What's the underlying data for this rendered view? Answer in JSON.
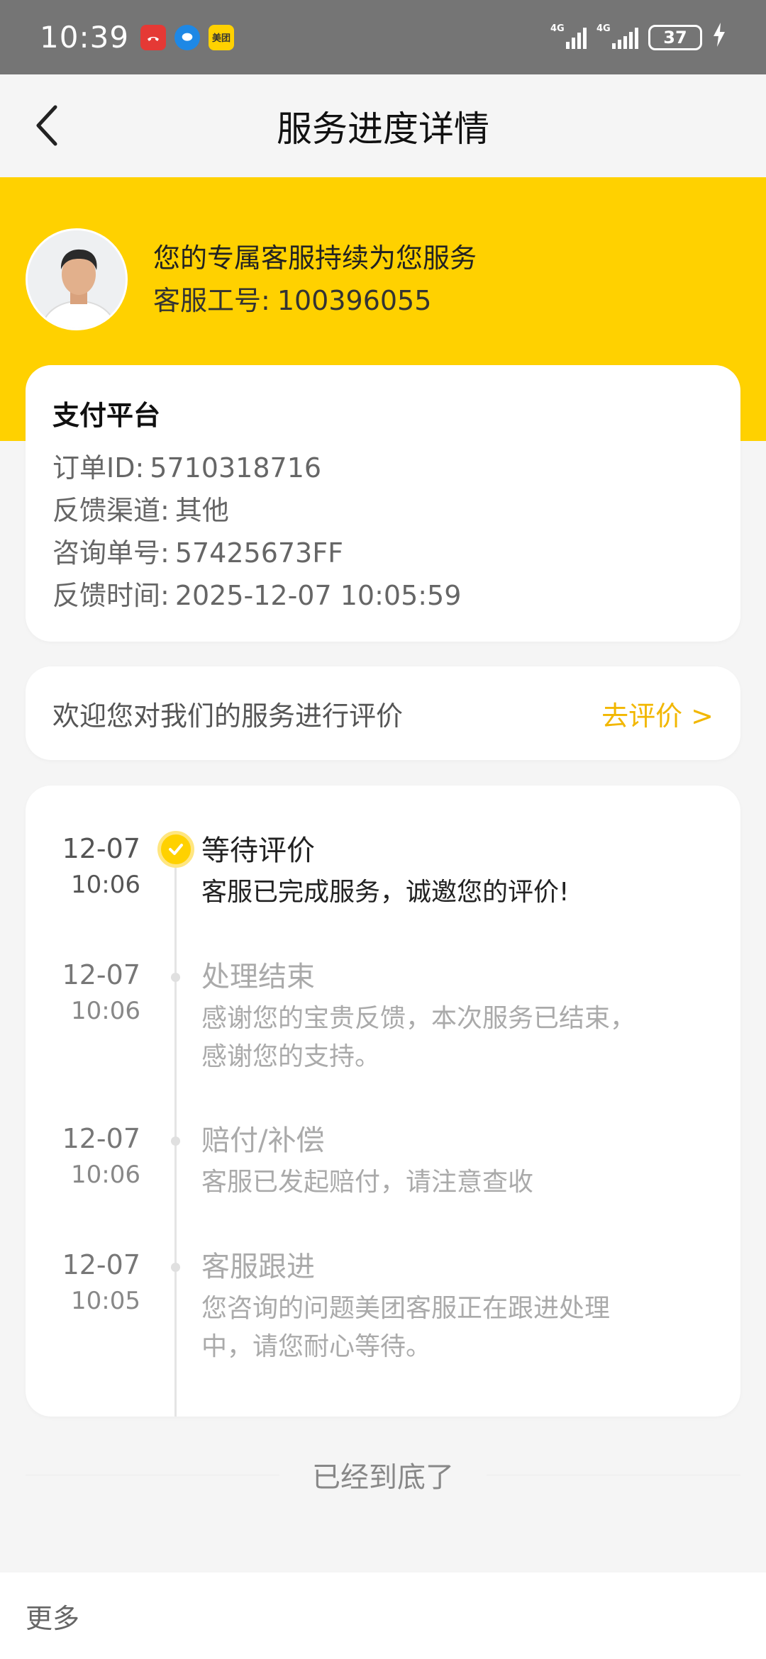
{
  "status_bar": {
    "time": "10:39",
    "notifications": [
      "missed-call-icon",
      "message-icon",
      "meituan-app-icon"
    ],
    "meituan_badge": "美团",
    "signal_label_1": "4G",
    "signal_label_2": "4G",
    "battery": "37"
  },
  "nav": {
    "title": "服务进度详情"
  },
  "agent": {
    "line1": "您的专属客服持续为您服务",
    "id_label": "客服工号:",
    "id_value": "100396055"
  },
  "info": {
    "title": "支付平台",
    "rows": [
      {
        "label": "订单ID:",
        "value": "5710318716"
      },
      {
        "label": "反馈渠道:",
        "value": "其他"
      },
      {
        "label": "咨询单号:",
        "value": "57425673FF"
      },
      {
        "label": "反馈时间:",
        "value": "2025-12-07 10:05:59"
      }
    ]
  },
  "review": {
    "text": "欢迎您对我们的服务进行评价",
    "link": "去评价 >"
  },
  "timeline": [
    {
      "date": "12-07",
      "time": "10:06",
      "title": "等待评价",
      "desc": "客服已完成服务，诚邀您的评价!",
      "active": true
    },
    {
      "date": "12-07",
      "time": "10:06",
      "title": "处理结束",
      "desc_lines": [
        "感谢您的宝贵反馈，本次服务已结束，",
        "感谢您的支持。"
      ],
      "active": false
    },
    {
      "date": "12-07",
      "time": "10:06",
      "title": "赔付/补偿",
      "desc": "客服已发起赔付，请注意查收",
      "active": false
    },
    {
      "date": "12-07",
      "time": "10:05",
      "title": "客服跟进",
      "desc_lines": [
        "您咨询的问题美团客服正在跟进处理",
        "中，请您耐心等待。"
      ],
      "active": false
    }
  ],
  "footer": {
    "end_text": "已经到底了",
    "more": "更多"
  },
  "colors": {
    "brand_yellow": "#ffd100",
    "link_yellow": "#f2b700"
  }
}
